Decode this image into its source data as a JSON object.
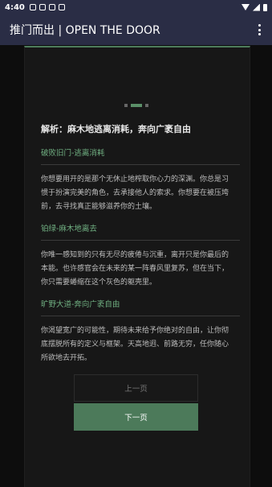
{
  "status_bar": {
    "time": "4:40",
    "icons": [
      "notification-icon",
      "notification-icon",
      "notification-icon",
      "notification-icon",
      "wifi-icon",
      "signal-icon",
      "battery-icon"
    ]
  },
  "app_bar": {
    "title": "推门而出 | OPEN THE DOOR",
    "menu_icon": "more-vert-icon"
  },
  "colors": {
    "app_bar_bg": "#2a2d45",
    "accent_green": "#4c7a5a",
    "section_title": "#6fae80",
    "background": "#0d0d0d"
  },
  "pager": {
    "total": 3,
    "current": 2
  },
  "content": {
    "heading": "解析：麻木地逃离消耗，奔向广袤自由",
    "sections": [
      {
        "title": "破败旧门-逃离消耗",
        "lines": [
          "你想要用开的是那个无休止地榨取你心力的深渊。你总是习",
          "惯于扮演完美的角色，去承接他人的索求。你想要在被压垮",
          "前，去寻找真正能够滋养你的土壤。"
        ]
      },
      {
        "title": "铂绿-麻木地离去",
        "lines": [
          "你唯一感知到的只有无尽的疲倦与沉重，离开只是你最后的",
          "本能。也许感官会在未来的某一阵春风里复苏，但在当下，",
          "你只需要蜷缩在这个灰色的躯壳里。"
        ]
      },
      {
        "title": "旷野大道-奔向广袤自由",
        "lines": [
          "你渴望宽广的可能性，期待未来给予你绝对的自由，让你彻",
          "底摆脱所有的定义与框架。天高地迥、前路无穷，任你随心",
          "所欲地去开拓。"
        ]
      }
    ]
  },
  "buttons": {
    "prev_label": "上一页",
    "next_label": "下一页"
  }
}
